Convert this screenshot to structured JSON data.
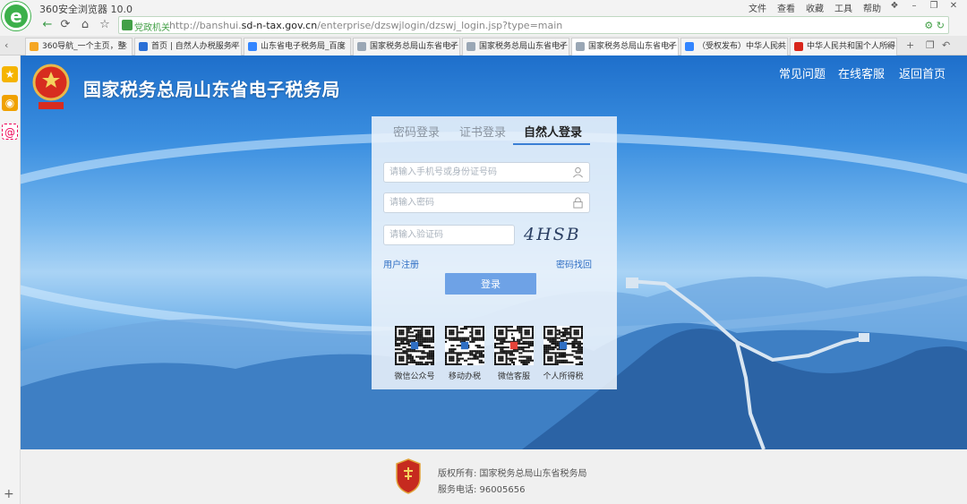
{
  "browser": {
    "title": "360安全浏览器 10.0",
    "menu": [
      "文件",
      "查看",
      "收藏",
      "工具",
      "帮助"
    ],
    "site_badge": "党政机关",
    "url_prefix": "http://banshui.",
    "url_domain": "sd-n-tax.gov.cn",
    "url_path": "/enterprise/dzswjlogin/dzswj_login.jsp?type=main"
  },
  "tabs": [
    {
      "label": "360导航_一个主页，整",
      "color": "#f5a623",
      "active": false
    },
    {
      "label": "首页 | 自然人办税服务平",
      "color": "#2a6fd6",
      "active": false
    },
    {
      "label": "山东省电子税务局_百度",
      "color": "#3385ff",
      "active": false
    },
    {
      "label": "国家税务总局山东省电子",
      "color": "#9aa7b5",
      "active": false
    },
    {
      "label": "国家税务总局山东省电子",
      "color": "#9aa7b5",
      "active": false
    },
    {
      "label": "国家税务总局山东省电子",
      "color": "#9aa7b5",
      "active": true
    },
    {
      "label": "（受权发布）中华人民共",
      "color": "#3385ff",
      "active": false
    },
    {
      "label": "中华人民共和国个人所得",
      "color": "#d8261c",
      "active": false
    }
  ],
  "site": {
    "title": "国家税务总局山东省电子税务局",
    "nav": [
      "常见问题",
      "在线客服",
      "返回首页"
    ]
  },
  "login": {
    "tabs": [
      "密码登录",
      "证书登录",
      "自然人登录"
    ],
    "active_tab": "自然人登录",
    "id_placeholder": "请输入手机号或身份证号码",
    "password_placeholder": "请输入密码",
    "captcha_placeholder": "请输入验证码",
    "captcha_text": "4HSB",
    "register_link": "用户注册",
    "recover_link": "密码找回",
    "submit_label": "登录",
    "accent_color": "#3a7fd5"
  },
  "qrcodes": [
    {
      "label": "微信公众号",
      "icon": "wechat-icon"
    },
    {
      "label": "移动办税",
      "icon": "mobile-tax-icon"
    },
    {
      "label": "微信客服",
      "icon": "customer-service-icon"
    },
    {
      "label": "个人所得税",
      "icon": "iit-icon"
    }
  ],
  "footer": {
    "copyright": "版权所有: 国家税务总局山东省税务局",
    "phone": "服务电话: 96005656"
  }
}
